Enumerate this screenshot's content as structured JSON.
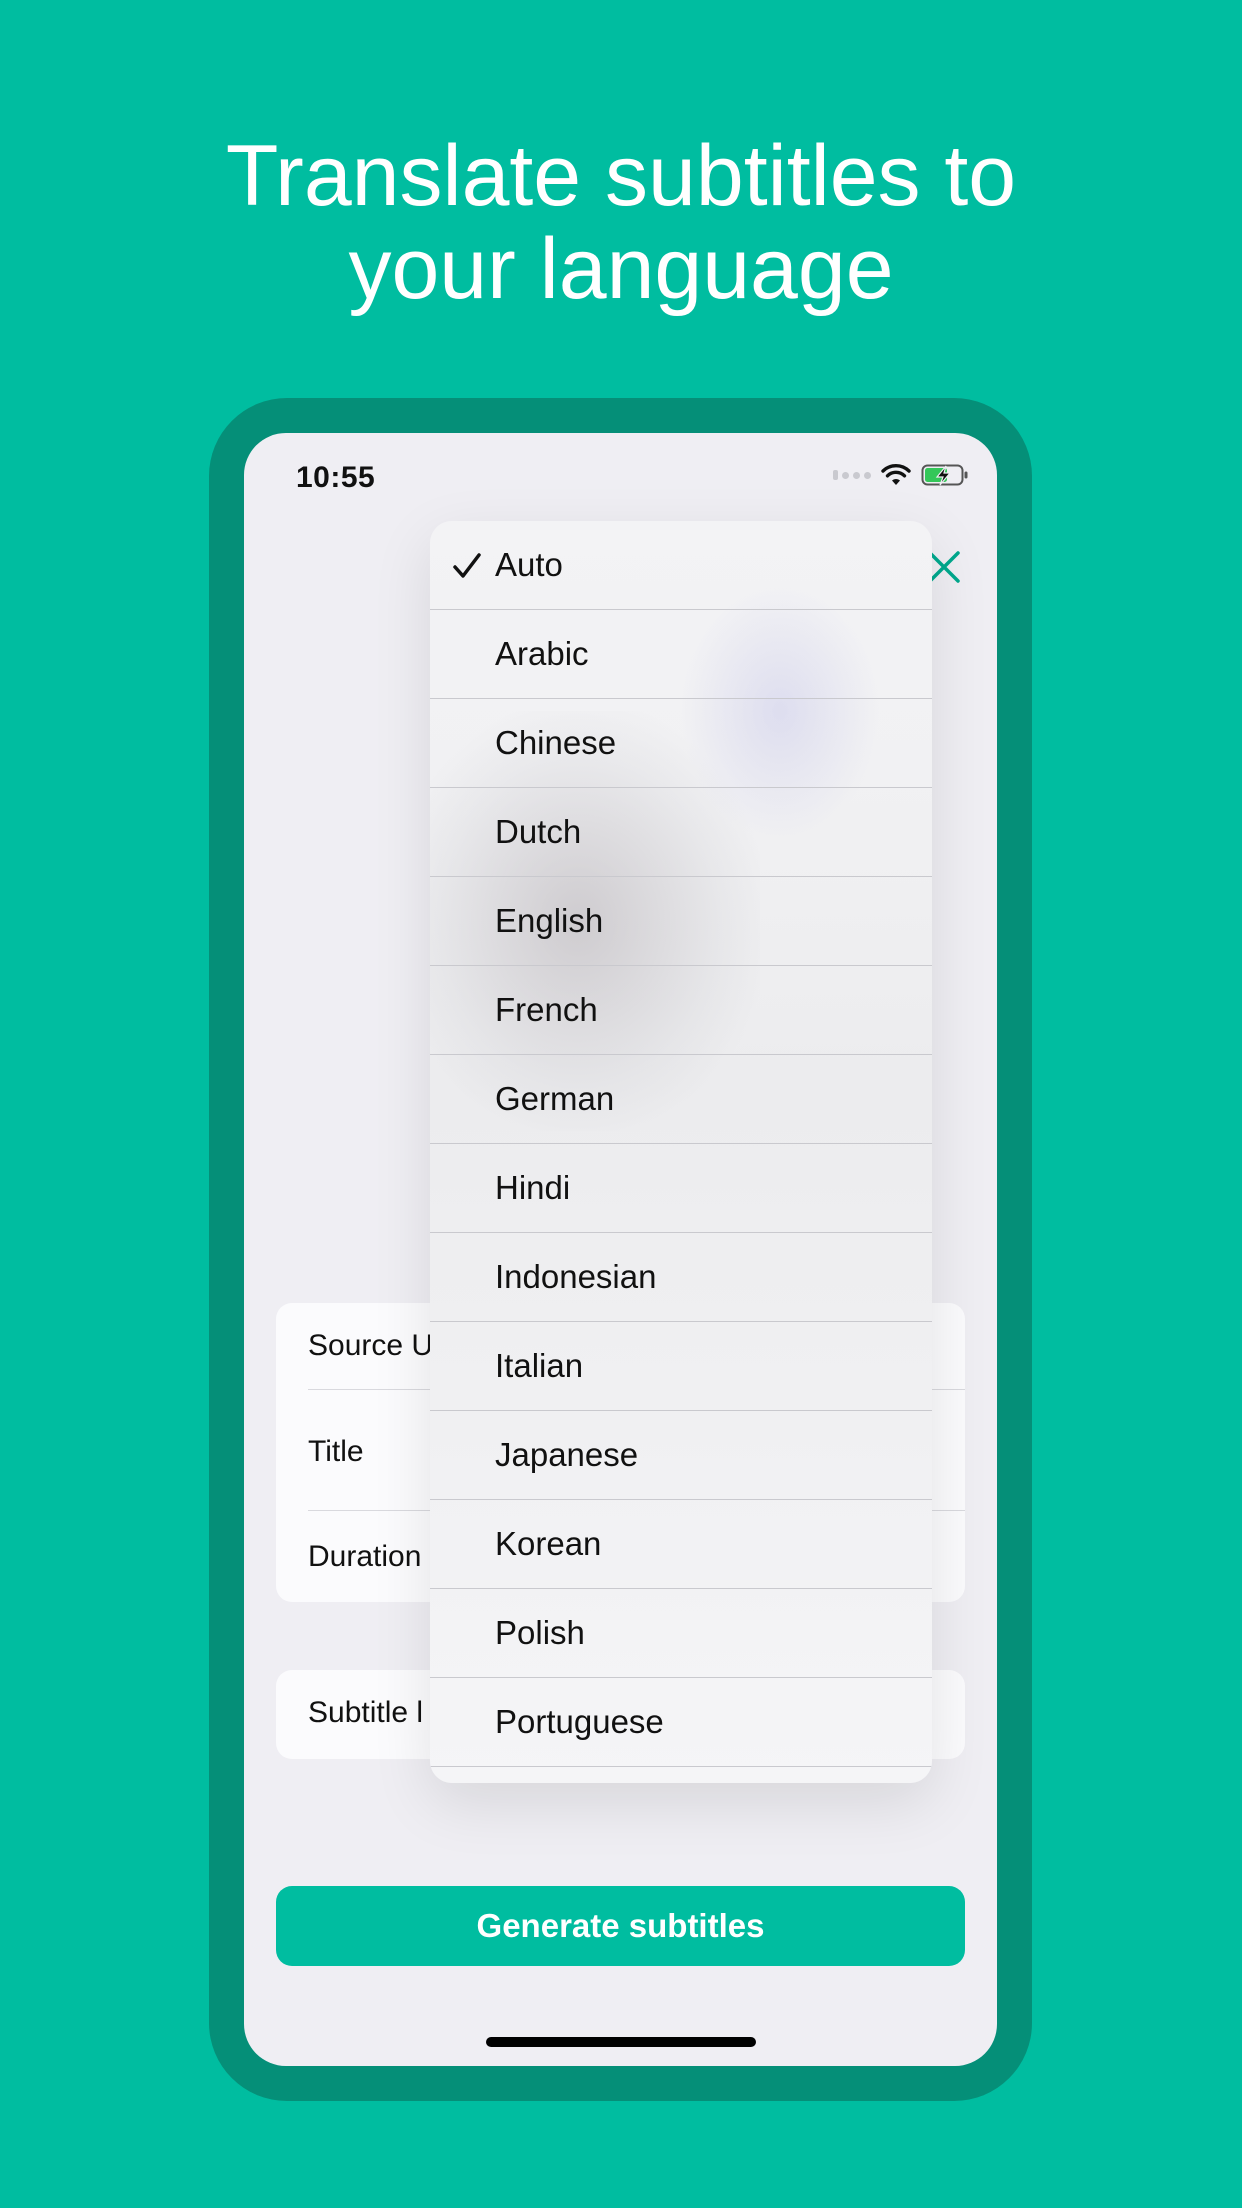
{
  "headline": {
    "line1": "Translate subtitles to",
    "line2": "your language"
  },
  "status_bar": {
    "time": "10:55"
  },
  "form": {
    "source_label": "Source U",
    "title_label": "Title",
    "duration_label": "Duration",
    "subtitle_label": "Subtitle l"
  },
  "generate_button": "Generate subtitles",
  "language_menu": {
    "selected": "Auto",
    "items": [
      "Auto",
      "Arabic",
      "Chinese",
      "Dutch",
      "English",
      "French",
      "German",
      "Hindi",
      "Indonesian",
      "Italian",
      "Japanese",
      "Korean",
      "Polish",
      "Portuguese"
    ]
  },
  "colors": {
    "brand": "#00bda0",
    "device_frame": "#058f78"
  },
  "icons": [
    "wifi-icon",
    "battery-charging-icon",
    "close-icon",
    "checkmark-icon"
  ]
}
